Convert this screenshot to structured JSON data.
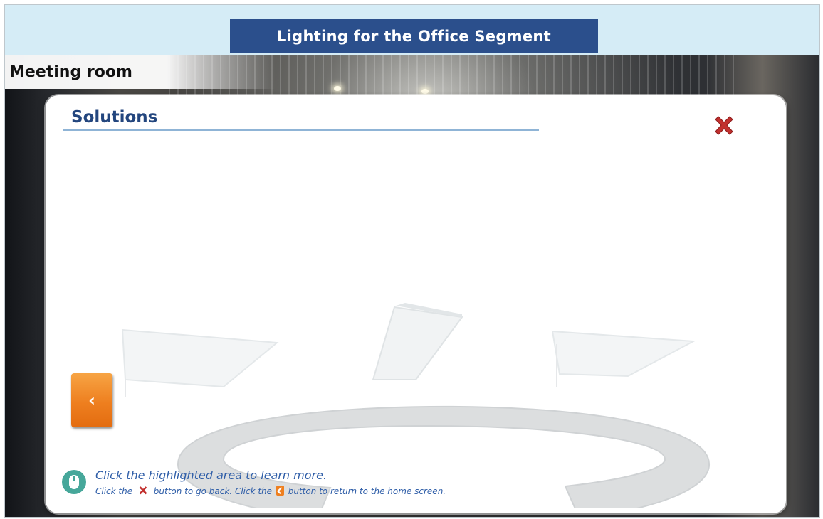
{
  "header": {
    "title": "Lighting for the Office Segment"
  },
  "scene": {
    "room_label": "Meeting room"
  },
  "panel": {
    "title": "Solutions",
    "close_icon": "close-x-icon",
    "back_icon": "chevron-left-icon",
    "back_label": "‹"
  },
  "hint": {
    "icon": "mouse-icon",
    "line1": "Click the highlighted area to learn more.",
    "line2_part1": "Click the",
    "line2_part2": "button to go back. Click the",
    "line2_part3": "button to return to the home screen."
  },
  "colors": {
    "header_bg": "#d5ecf6",
    "title_bg": "#2b4f8c",
    "accent_blue": "#23467e",
    "close_red": "#c2302e",
    "back_orange": "#ee7f1f"
  }
}
